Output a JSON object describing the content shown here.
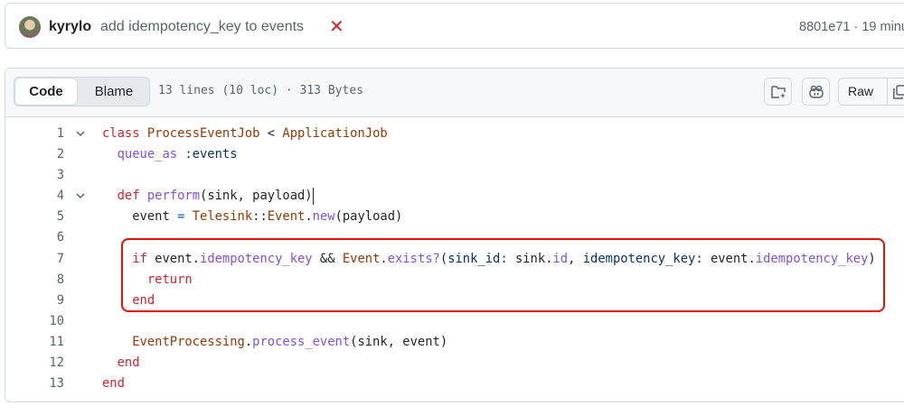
{
  "commit": {
    "author": "kyrylo",
    "message": "add idempotency_key to events",
    "status_icon": "x-mark-failed",
    "sha_and_time": "8801e71 · 19 minu"
  },
  "file_header": {
    "tabs": [
      {
        "label": "Code",
        "active": true
      },
      {
        "label": "Blame",
        "active": false
      }
    ],
    "meta": "13 lines (10 loc) · 313 Bytes",
    "raw_label": "Raw",
    "icons": [
      "folder-sparkle-icon",
      "copilot-icon",
      "copy-icon"
    ]
  },
  "code": {
    "lines": [
      {
        "n": "1",
        "fold": true,
        "tokens": [
          [
            "class",
            "k"
          ],
          [
            " "
          ],
          [
            "ProcessEventJob",
            "c"
          ],
          [
            " < "
          ],
          [
            "ApplicationJob",
            "c"
          ]
        ]
      },
      {
        "n": "2",
        "tokens": [
          [
            "  "
          ],
          [
            "queue_as",
            "m"
          ],
          [
            " "
          ],
          [
            ":events",
            "s"
          ]
        ]
      },
      {
        "n": "3",
        "tokens": []
      },
      {
        "n": "4",
        "fold": true,
        "cursor": true,
        "tokens": [
          [
            "  "
          ],
          [
            "def",
            "k"
          ],
          [
            " "
          ],
          [
            "perform",
            "m"
          ],
          [
            "(sink, payload)"
          ]
        ]
      },
      {
        "n": "5",
        "tokens": [
          [
            "    event "
          ],
          [
            "=",
            "o"
          ],
          [
            " "
          ],
          [
            "Telesink",
            "c"
          ],
          [
            "::"
          ],
          [
            "Event",
            "c"
          ],
          [
            "."
          ],
          [
            "new",
            "m"
          ],
          [
            "(payload)"
          ]
        ]
      },
      {
        "n": "6",
        "tokens": []
      },
      {
        "n": "7",
        "tokens": [
          [
            "    "
          ],
          [
            "if",
            "k"
          ],
          [
            " event."
          ],
          [
            "idempotency_key",
            "m"
          ],
          [
            " && "
          ],
          [
            "Event",
            "c"
          ],
          [
            "."
          ],
          [
            "exists?",
            "m"
          ],
          [
            "("
          ],
          [
            "sink_id:",
            "s"
          ],
          [
            " sink."
          ],
          [
            "id",
            "m"
          ],
          [
            ", "
          ],
          [
            "idempotency_key:",
            "s"
          ],
          [
            " event."
          ],
          [
            "idempotency_key",
            "m"
          ],
          [
            ")"
          ]
        ]
      },
      {
        "n": "8",
        "tokens": [
          [
            "      "
          ],
          [
            "return",
            "k"
          ]
        ]
      },
      {
        "n": "9",
        "tokens": [
          [
            "    "
          ],
          [
            "end",
            "k"
          ]
        ]
      },
      {
        "n": "10",
        "tokens": []
      },
      {
        "n": "11",
        "tokens": [
          [
            "    "
          ],
          [
            "EventProcessing",
            "c"
          ],
          [
            "."
          ],
          [
            "process_event",
            "m"
          ],
          [
            "(sink, event)"
          ]
        ]
      },
      {
        "n": "12",
        "tokens": [
          [
            "  "
          ],
          [
            "end",
            "k"
          ]
        ]
      },
      {
        "n": "13",
        "tokens": [
          [
            "end",
            "k"
          ]
        ]
      }
    ]
  },
  "colors": {
    "highlight_box": "#e3120b",
    "keyword": "#cf222e",
    "constant": "#953800",
    "method": "#8250df"
  }
}
